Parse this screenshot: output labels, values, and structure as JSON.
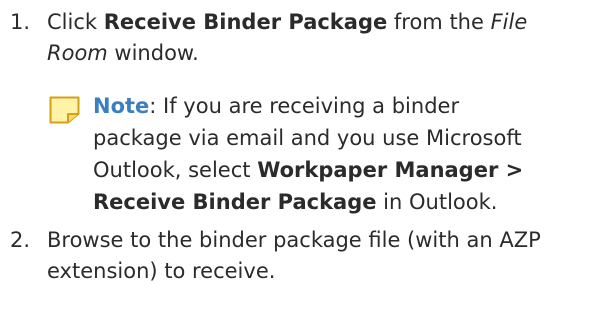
{
  "steps": [
    {
      "number": "1.",
      "line1_pre": "Click ",
      "line1_bold": "Receive Binder Package",
      "line1_mid": " from the ",
      "line1_italic": "File",
      "line2_italic": "Room",
      "line2_post": " window."
    },
    {
      "number": "2.",
      "line1": "Browse to the binder package file (with an AZP",
      "line2": "extension) to receive."
    }
  ],
  "note": {
    "icon": "note-icon",
    "label": "Note",
    "line1_post": ": If you are receiving a binder",
    "line2": "package via email and you use Microsoft",
    "line3_pre": "Outlook, select ",
    "line3_bold": "Workpaper Manager >",
    "line4_bold": "Receive Binder Package",
    "line4_post": " in Outlook."
  },
  "colors": {
    "note_label": "#3a7fbf",
    "note_icon_fill": "#fff3a8",
    "note_icon_stroke": "#d4a017",
    "text": "#2b2b2b"
  }
}
